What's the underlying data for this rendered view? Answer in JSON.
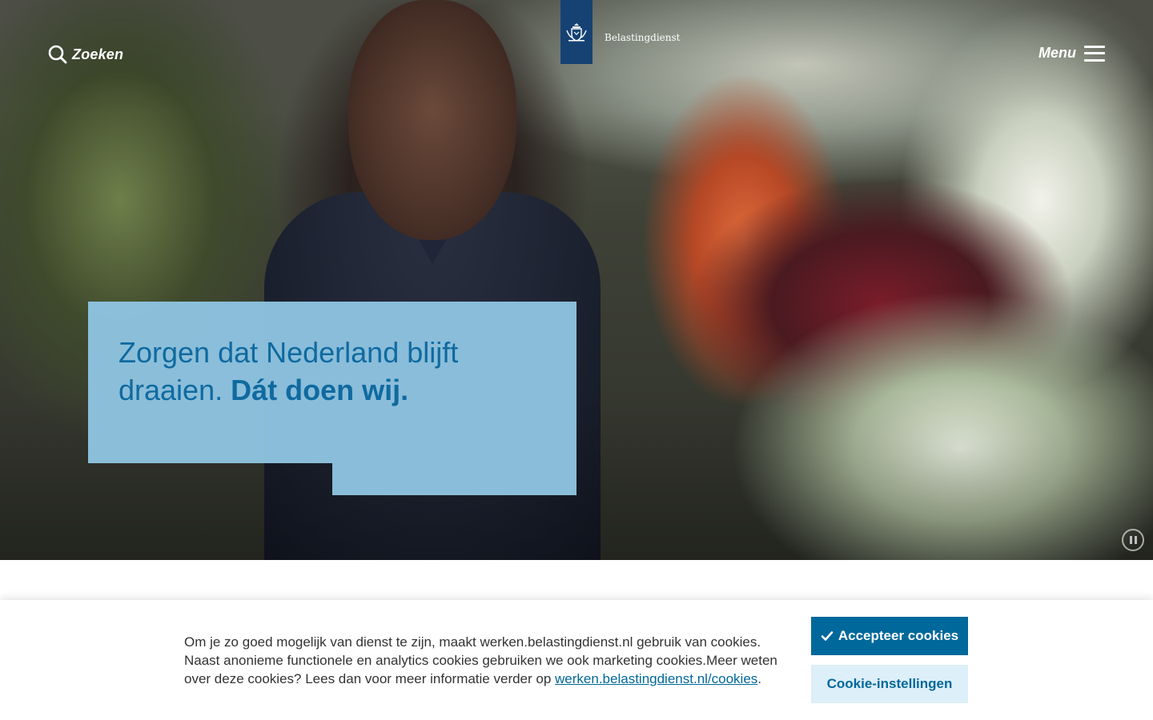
{
  "header": {
    "search_label": "Zoeken",
    "menu_label": "Menu",
    "logo_text": "Belastingdienst"
  },
  "hero": {
    "tagline_regular": "Zorgen dat Nederland blijft draaien.",
    "tagline_bold": "Dát doen wij."
  },
  "cookie_banner": {
    "text": "Om je zo goed mogelijk van dienst te zijn, maakt werken.belastingdienst.nl gebruik van cookies. Naast anonieme functionele en analytics cookies gebruiken we ook marketing cookies.Meer weten over deze cookies? Lees dan voor meer informatie verder op ",
    "link_text": "werken.belastingdienst.nl/cookies",
    "text_end": ".",
    "accept_label": "Accepteer cookies",
    "settings_label": "Cookie-instellingen"
  },
  "colors": {
    "brand_blue": "#01689b",
    "logo_ribbon": "#154273",
    "tagline_box": "#8fc4e1",
    "settings_button_bg": "#ddeff8"
  },
  "icons": [
    "search-icon",
    "hamburger-icon",
    "crest-icon",
    "pause-icon",
    "check-icon"
  ]
}
